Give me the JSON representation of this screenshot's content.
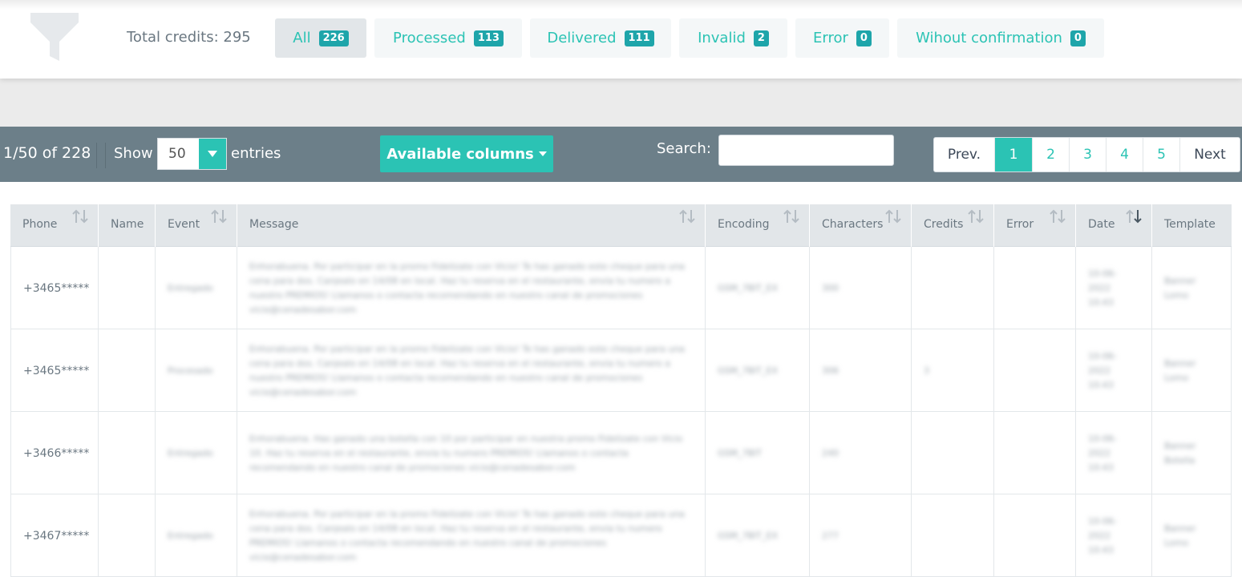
{
  "filters": {
    "total_credits": "Total credits: 295",
    "tabs": [
      {
        "label": "All",
        "count": "226"
      },
      {
        "label": "Processed",
        "count": "113"
      },
      {
        "label": "Delivered",
        "count": "111"
      },
      {
        "label": "Invalid",
        "count": "2"
      },
      {
        "label": "Error",
        "count": "0"
      },
      {
        "label": "Wihout confirmation",
        "count": "0"
      }
    ]
  },
  "toolbar": {
    "range": "1/50 of 228",
    "show_label": "Show",
    "show_value": "50",
    "entries_label": "entries",
    "available_columns": "Available columns",
    "search_label": "Search:",
    "search_value": "",
    "prev": "Prev.",
    "pages": [
      "1",
      "2",
      "3",
      "4",
      "5"
    ],
    "next": "Next",
    "current_page": "1"
  },
  "table": {
    "columns": [
      "Phone",
      "Name",
      "Event",
      "Message",
      "Encoding",
      "Characters",
      "Credits",
      "Error",
      "Date",
      "Template"
    ],
    "rows": [
      {
        "phone": "+3465*****",
        "name": "",
        "event": "Entregado",
        "message": "Enhorabuena. Por participar en la promo Fidelizate con Vicio! Te has ganado este cheque para una cena para dos. Canjealo en 14/08 en local. Haz tu reserva en el restaurante, envia tu numero a nuestro PREMIOS! Llamanos o contacta recomendando en nuestro canal de promociones vicio@cenadesabor.com",
        "encoding": "GSM_7BIT_EX",
        "characters": "300",
        "credits": "",
        "error": "",
        "date": "10-06-2022 10:43",
        "template": "Banner Lomo"
      },
      {
        "phone": "+3465*****",
        "name": "",
        "event": "Procesado",
        "message": "Enhorabuena. Por participar en la promo Fidelizate con Vicio! Te has ganado este cheque para una cena para dos. Canjealo en 14/08 en local. Haz tu reserva en el restaurante, envia tu numero a nuestro PREMIOS! Llamanos o contacta recomendando en nuestro canal de promociones vicio@cenadesabor.com",
        "encoding": "GSM_7BIT_EX",
        "characters": "306",
        "credits": "3",
        "error": "",
        "date": "10-06-2022 10:43",
        "template": "Banner Lomo"
      },
      {
        "phone": "+3466*****",
        "name": "",
        "event": "Entregado",
        "message": "Enhorabuena. Has ganado una botella con 10 por participar en nuestra promo Fidelizate con Vicio 10. Haz tu reserva en el restaurante, envia tu numero PREMIOS! Llamanos o contacta recomendando en nuestro canal de promociones vicio@cenadesabor.com",
        "encoding": "GSM_7BIT",
        "characters": "240",
        "credits": "",
        "error": "",
        "date": "10-06-2022 10:43",
        "template": "Banner Botella"
      },
      {
        "phone": "+3467*****",
        "name": "",
        "event": "Entregado",
        "message": "Enhorabuena. Por participar en la promo Fidelizate con Vicio! Te has ganado este cheque para una cena para dos. Canjealo en 14/08 en local. Haz tu reserva en el restaurante, envia tu numero PREMIOS! Llamanos o contacta recomendando en nuestro canal de promociones vicio@cenadesabor.com",
        "encoding": "GSM_7BIT_EX",
        "characters": "277",
        "credits": "",
        "error": "",
        "date": "10-06-2022 10:43",
        "template": "Banner Lomo"
      }
    ]
  },
  "colors": {
    "accent": "#2bc3b4",
    "badge": "#1ea5aa",
    "toolbar": "#6c7f89",
    "header": "#e2e6e9"
  },
  "icons": {
    "filter": "filter-funnel-icon",
    "sort": "sort-arrows-icon",
    "sort_active": "sort-desc-icon",
    "caret": "caret-down-icon"
  }
}
